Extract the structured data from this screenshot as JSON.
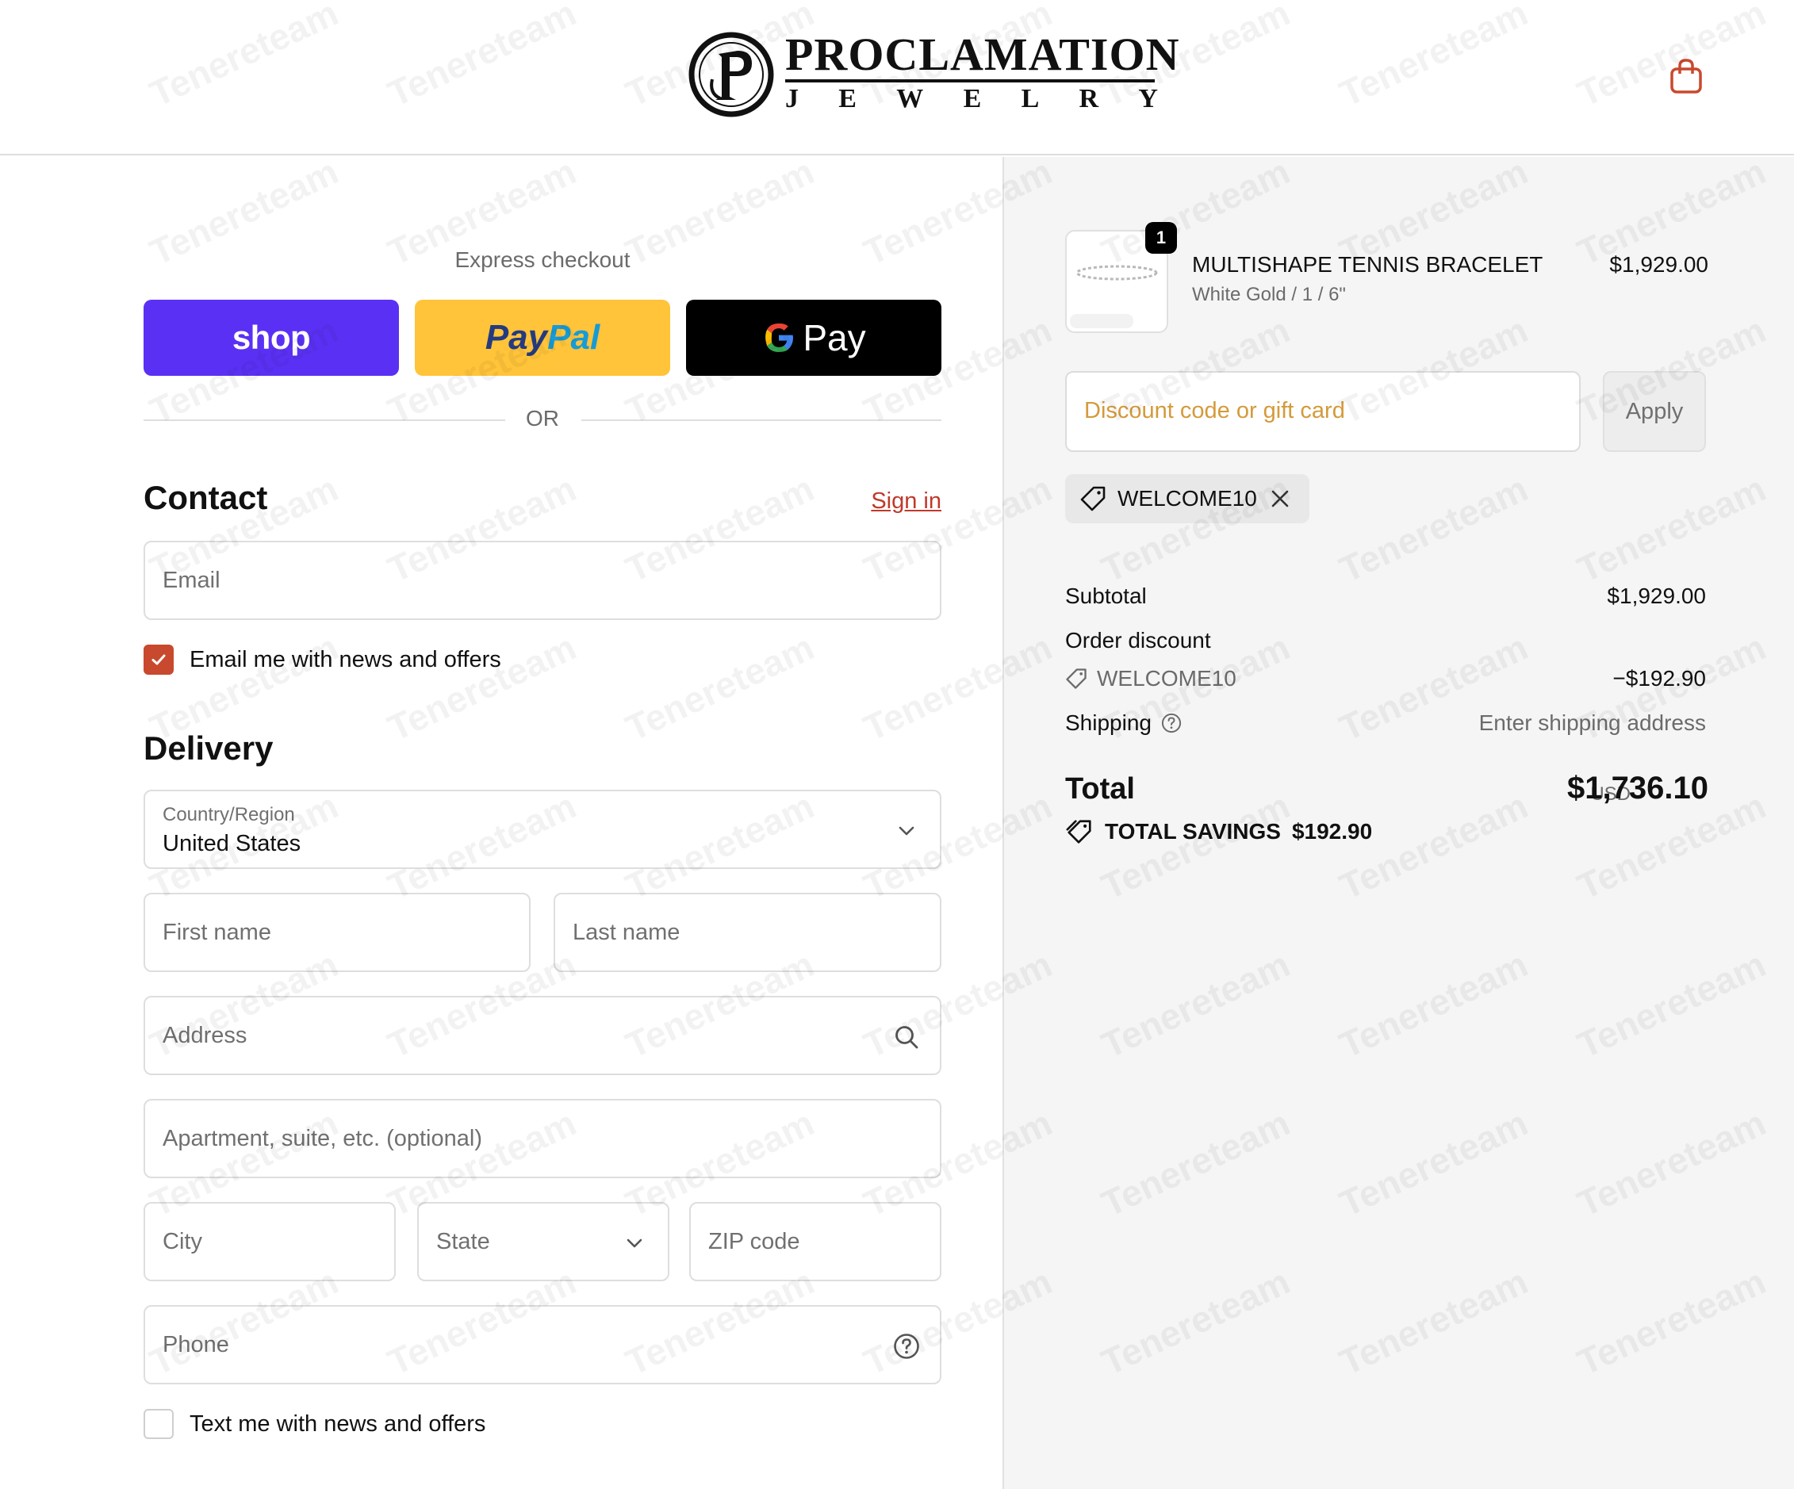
{
  "brand": {
    "name": "PROCLAMATION",
    "sub_letters": [
      "J",
      "E",
      "W",
      "E",
      "L",
      "R",
      "Y"
    ]
  },
  "icons": {
    "cart": "shopping-bag-icon",
    "search": "search-icon",
    "help": "help-circle-icon",
    "chevron": "chevron-down-icon",
    "tag": "tag-icon",
    "close": "close-icon",
    "check": "check-icon"
  },
  "colors": {
    "shop": "#5a31f4",
    "paypal": "#ffc439",
    "gpay": "#000000",
    "accent": "#c8492d",
    "link": "#c0392b",
    "placeholder_discount": "#d49a3a"
  },
  "express": {
    "label": "Express checkout",
    "shop_label": "shop",
    "paypal_part1": "Pay",
    "paypal_part2": "Pal",
    "gpay_label": "Pay",
    "or_label": "OR"
  },
  "contact": {
    "title": "Contact",
    "sign_in": "Sign in",
    "email_placeholder": "Email",
    "newsletter_label": "Email me with news and offers",
    "newsletter_checked": true
  },
  "delivery": {
    "title": "Delivery",
    "country_label": "Country/Region",
    "country_value": "United States",
    "first_name": "First name",
    "last_name": "Last name",
    "address": "Address",
    "apartment": "Apartment, suite, etc. (optional)",
    "city": "City",
    "state": "State",
    "zip": "ZIP code",
    "phone": "Phone",
    "sms_label": "Text me with news and offers",
    "sms_checked": false
  },
  "summary": {
    "item": {
      "quantity": "1",
      "name": "MULTISHAPE TENNIS BRACELET",
      "variant": "White Gold / 1 / 6\"",
      "price": "$1,929.00"
    },
    "discount_placeholder": "Discount code or gift card",
    "apply_label": "Apply",
    "applied_code": "WELCOME10",
    "subtotal_label": "Subtotal",
    "subtotal_value": "$1,929.00",
    "order_discount_label": "Order discount",
    "discount_code": "WELCOME10",
    "discount_value": "−$192.90",
    "shipping_label": "Shipping",
    "shipping_value": "Enter shipping address",
    "total_label": "Total",
    "total_currency": "USD",
    "total_value": "$1,736.10",
    "savings_label": "TOTAL SAVINGS",
    "savings_value": "$192.90"
  },
  "watermark": "Tenereteam"
}
